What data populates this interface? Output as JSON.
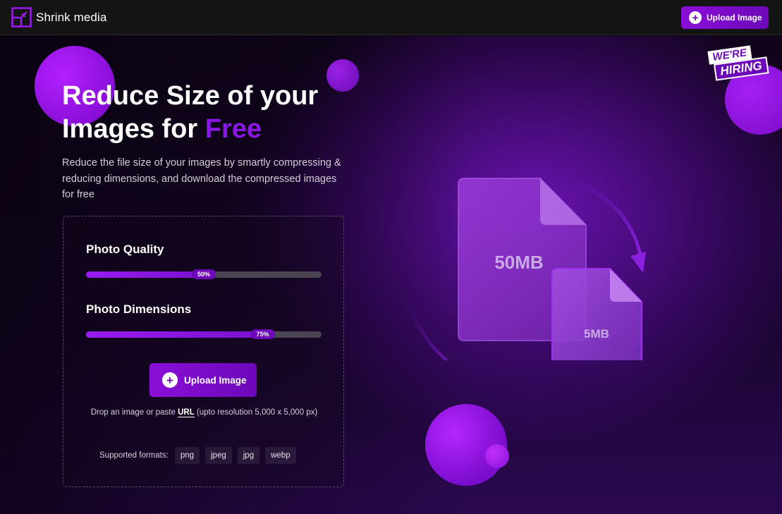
{
  "header": {
    "logo_text": "Shrink media",
    "upload_label": "Upload Image",
    "upload_icon": "plus-icon"
  },
  "hero": {
    "title_line1": "Reduce Size of your",
    "title_line2": "Images for ",
    "title_accent": "Free",
    "subtitle": "Reduce the file size of your images by smartly compressing & reducing dimensions, and download the compressed images for free",
    "hiring_line1": "WE'RE",
    "hiring_line2": "HIRING"
  },
  "controls": {
    "quality_label": "Photo Quality",
    "quality_value": 50,
    "quality_text": "50%",
    "dimensions_label": "Photo Dimensions",
    "dimensions_value": 75,
    "dimensions_text": "75%",
    "upload_label": "Upload Image",
    "drop_prefix": "Drop an image or paste ",
    "drop_url": "URL",
    "drop_suffix": " (upto resolution 5,000 x 5,000 px)",
    "formats_label": "Supported formats:",
    "formats": [
      "png",
      "jpeg",
      "jpg",
      "webp"
    ]
  },
  "illustration": {
    "big_file_label": "50MB",
    "small_file_label": "5MB"
  },
  "colors": {
    "accent": "#8a0fd8",
    "accent_dark": "#6d08b9",
    "topbar_bg": "#141414"
  }
}
